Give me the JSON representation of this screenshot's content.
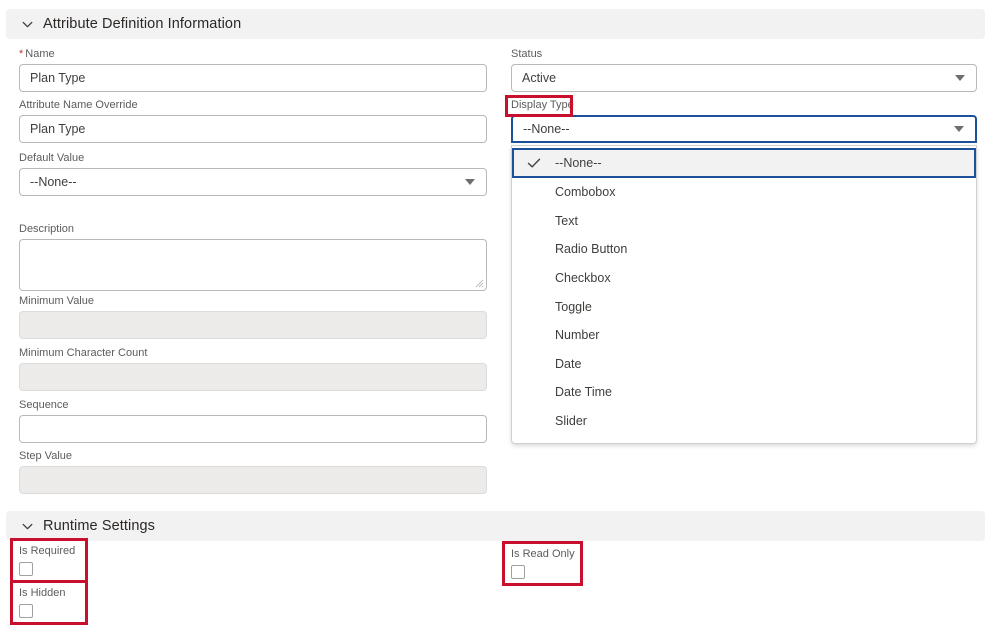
{
  "sections": {
    "attribute_definition": {
      "title": "Attribute Definition Information",
      "chevron_icon": "chevron-down-icon"
    },
    "runtime_settings": {
      "title": "Runtime Settings",
      "chevron_icon": "chevron-down-icon"
    }
  },
  "left_column": {
    "name": {
      "label": "Name",
      "required_marker": "*",
      "value": "Plan Type"
    },
    "attribute_name_override": {
      "label": "Attribute Name Override",
      "value": "Plan Type"
    },
    "default_value": {
      "label": "Default Value",
      "value": "--None--",
      "arrow_icon": "chevron-down-icon"
    },
    "description": {
      "label": "Description",
      "value": "",
      "resize_icon": "resize-grip-icon"
    },
    "minimum_value": {
      "label": "Minimum Value",
      "value": "",
      "state": "disabled"
    },
    "minimum_character_count": {
      "label": "Minimum Character Count",
      "value": "",
      "state": "disabled"
    },
    "sequence": {
      "label": "Sequence",
      "value": ""
    },
    "step_value": {
      "label": "Step Value",
      "value": "",
      "state": "disabled"
    }
  },
  "right_column": {
    "status": {
      "label": "Status",
      "value": "Active",
      "arrow_icon": "chevron-down-icon"
    },
    "display_type": {
      "label": "Display Type",
      "value": "--None--",
      "arrow_icon": "chevron-down-icon",
      "expanded": true,
      "selected_option": "--None--",
      "check_icon": "check-icon",
      "options": [
        "--None--",
        "Combobox",
        "Text",
        "Radio Button",
        "Checkbox",
        "Toggle",
        "Number",
        "Date",
        "Date Time",
        "Slider"
      ]
    }
  },
  "runtime_settings_fields": {
    "is_required": {
      "label": "Is Required",
      "checked": false
    },
    "is_hidden": {
      "label": "Is Hidden",
      "checked": false
    },
    "is_read_only": {
      "label": "Is Read Only",
      "checked": false
    }
  },
  "colors": {
    "annotation_red": "#C8102E",
    "focus_blue": "#1B5297",
    "required_asterisk": "#C23934",
    "section_header_bg": "#F3F2F2",
    "disabled_field_bg": "#ECEBEA"
  }
}
